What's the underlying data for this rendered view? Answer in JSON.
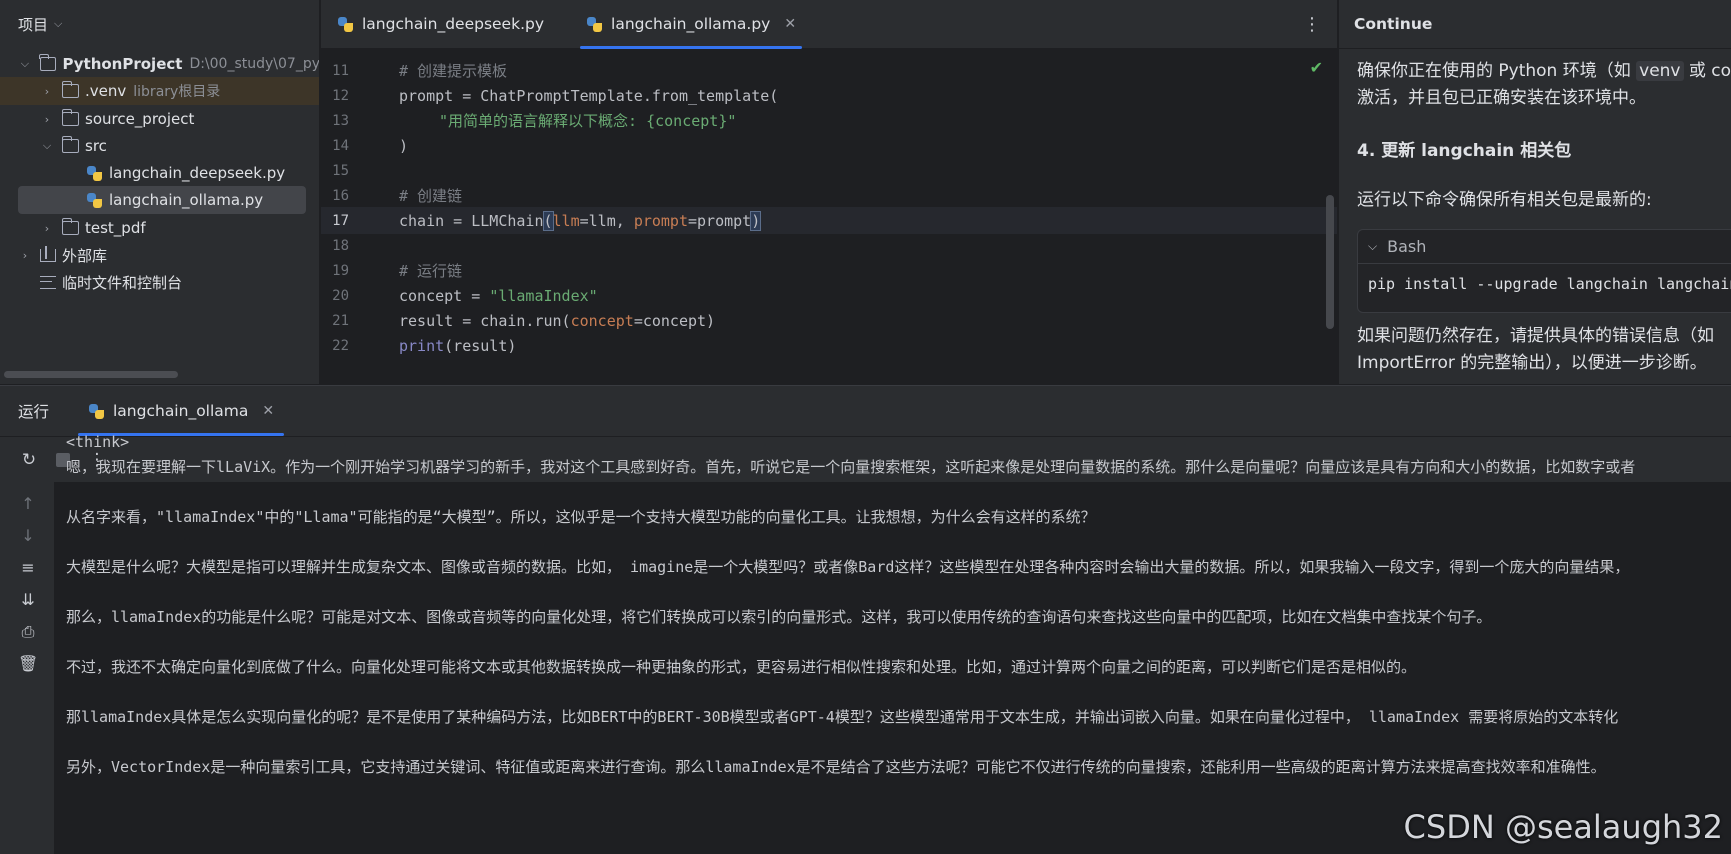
{
  "project": {
    "header": "项目",
    "root_name": "PythonProject",
    "root_path": "D:\\00_study\\07_py",
    "items": [
      {
        "name": ".venv",
        "note": "library根目录"
      },
      {
        "name": "source_project"
      },
      {
        "name": "src"
      },
      {
        "name": "langchain_deepseek.py"
      },
      {
        "name": "langchain_ollama.py"
      },
      {
        "name": "test_pdf"
      },
      {
        "name": "外部库"
      },
      {
        "name": "临时文件和控制台"
      }
    ]
  },
  "editor": {
    "tabs": [
      {
        "label": "langchain_deepseek.py"
      },
      {
        "label": "langchain_ollama.py"
      }
    ],
    "tab_close": "✕",
    "more": "⋮",
    "line_numbers": [
      "11",
      "12",
      "13",
      "14",
      "15",
      "16",
      "17",
      "18",
      "19",
      "20",
      "21",
      "22"
    ],
    "lines": {
      "l11": "# 创建提示模板",
      "l12": "prompt = ChatPromptTemplate.from_template(",
      "l13": "\"用简单的语言解释以下概念: {concept}\"",
      "l14": ")",
      "l16": "# 创建链",
      "l17_a": "chain = LLMChain",
      "l17_b": "(",
      "l17_c": "llm",
      "l17_d": "=llm, ",
      "l17_e": "prompt",
      "l17_f": "=prompt",
      "l17_g": ")",
      "l19": "# 运行链",
      "l20_a": "concept = ",
      "l20_b": "\"llamaIndex\"",
      "l21_a": "result = chain.run(",
      "l21_b": "concept",
      "l21_c": "=concept)",
      "l22_a": "print",
      "l22_b": "(result)"
    },
    "check": "✔"
  },
  "continue_panel": {
    "title": "Continue",
    "p1_a": "确保你正在使用的 Python 环境（如 ",
    "p1_code": "venv",
    "p1_b": " 或 cor",
    "p1_line2": "激活，并且包已正确安装在该环境中。",
    "heading": "4. 更新 langchain 相关包",
    "p2": "运行以下命令确保所有相关包是最新的:",
    "code_lang": "Bash",
    "code_cmd": "pip install --upgrade langchain langchain",
    "p3_line1": "如果问题仍然存在，请提供具体的错误信息（如",
    "p3_line2": "ImportError 的完整输出），以便进一步诊断。"
  },
  "run": {
    "label": "运行",
    "tab": "langchain_ollama",
    "output": [
      "<think>",
      "嗯，我现在要理解一下lLaViX。作为一个刚开始学习机器学习的新手，我对这个工具感到好奇。首先，听说它是一个向量搜索框架，这听起来像是处理向量数据的系统。那什么是向量呢？向量应该是具有方向和大小的数据，比如数字或者",
      "从名字来看，\"llamaIndex\"中的\"Llama\"可能指的是“大模型”。所以，这似乎是一个支持大模型功能的向量化工具。让我想想，为什么会有这样的系统？",
      "大模型是什么呢？大模型是指可以理解并生成复杂文本、图像或音频的数据。比如， imagine是一个大模型吗？或者像Bard这样？这些模型在处理各种内容时会输出大量的数据。所以，如果我输入一段文字，得到一个庞大的向量结果，",
      "那么，llamaIndex的功能是什么呢？可能是对文本、图像或音频等的向量化处理，将它们转换成可以索引的向量形式。这样，我可以使用传统的查询语句来查找这些向量中的匹配项，比如在文档集中查找某个句子。",
      "不过，我还不太确定向量化到底做了什么。向量化处理可能将文本或其他数据转换成一种更抽象的形式，更容易进行相似性搜索和处理。比如，通过计算两个向量之间的距离，可以判断它们是否是相似的。",
      "那llamaIndex具体是怎么实现向量化的呢？是不是使用了某种编码方法，比如BERT中的BERT-30B模型或者GPT-4模型？这些模型通常用于文本生成，并输出词嵌入向量。如果在向量化过程中， llamaIndex 需要将原始的文本转化",
      "另外，VectorIndex是一种向量索引工具，它支持通过关键词、特征值或距离来进行查询。那么llamaIndex是不是结合了这些方法呢？可能它不仅进行传统的向量搜索，还能利用一些高级的距离计算方法来提高查找效率和准确性。"
    ]
  },
  "watermark": "CSDN @sealaugh32"
}
